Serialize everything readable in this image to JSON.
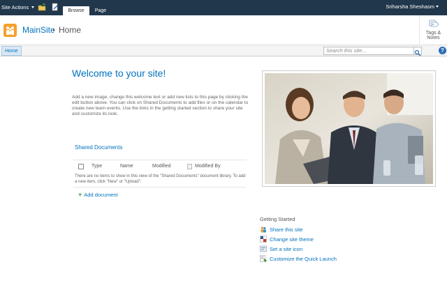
{
  "ribbon": {
    "site_actions": "Site Actions",
    "tabs": [
      {
        "label": "Browse"
      },
      {
        "label": "Page"
      }
    ],
    "user": "Sriharsha Sheshasm"
  },
  "header": {
    "site_title": "MainSite",
    "page": "Home",
    "tags_notes": [
      "Tags &",
      "Notes"
    ]
  },
  "nav": {
    "home": "Home",
    "search_placeholder": "Search this site...",
    "help": "?"
  },
  "main": {
    "welcome": "Welcome to your site!",
    "intro": "Add a new image, change this welcome text or add new lists to this page by clicking the edit button above. You can click on Shared Documents to add files or on the calendar to create new team events. Use the links in the getting started section to share your site and customize its look.",
    "shared_documents": {
      "title": "Shared Documents",
      "columns": [
        "Type",
        "Name",
        "Modified",
        "Modified By"
      ],
      "empty_message": "There are no items to show in this view of the \"Shared Documents\" document library. To add a new item, click \"New\" or \"Upload\".",
      "add_document": "Add document"
    }
  },
  "getting_started": {
    "title": "Getting Started",
    "items": [
      {
        "label": "Share this site",
        "icon": "share-site-icon"
      },
      {
        "label": "Change site theme",
        "icon": "theme-icon"
      },
      {
        "label": "Set a site icon",
        "icon": "site-icon-icon"
      },
      {
        "label": "Customize the Quick Launch",
        "icon": "quick-launch-icon"
      }
    ]
  },
  "colors": {
    "ribbon_bg": "#21374c",
    "link_blue": "#0072bc",
    "logo_orange": "#f5a12a"
  }
}
